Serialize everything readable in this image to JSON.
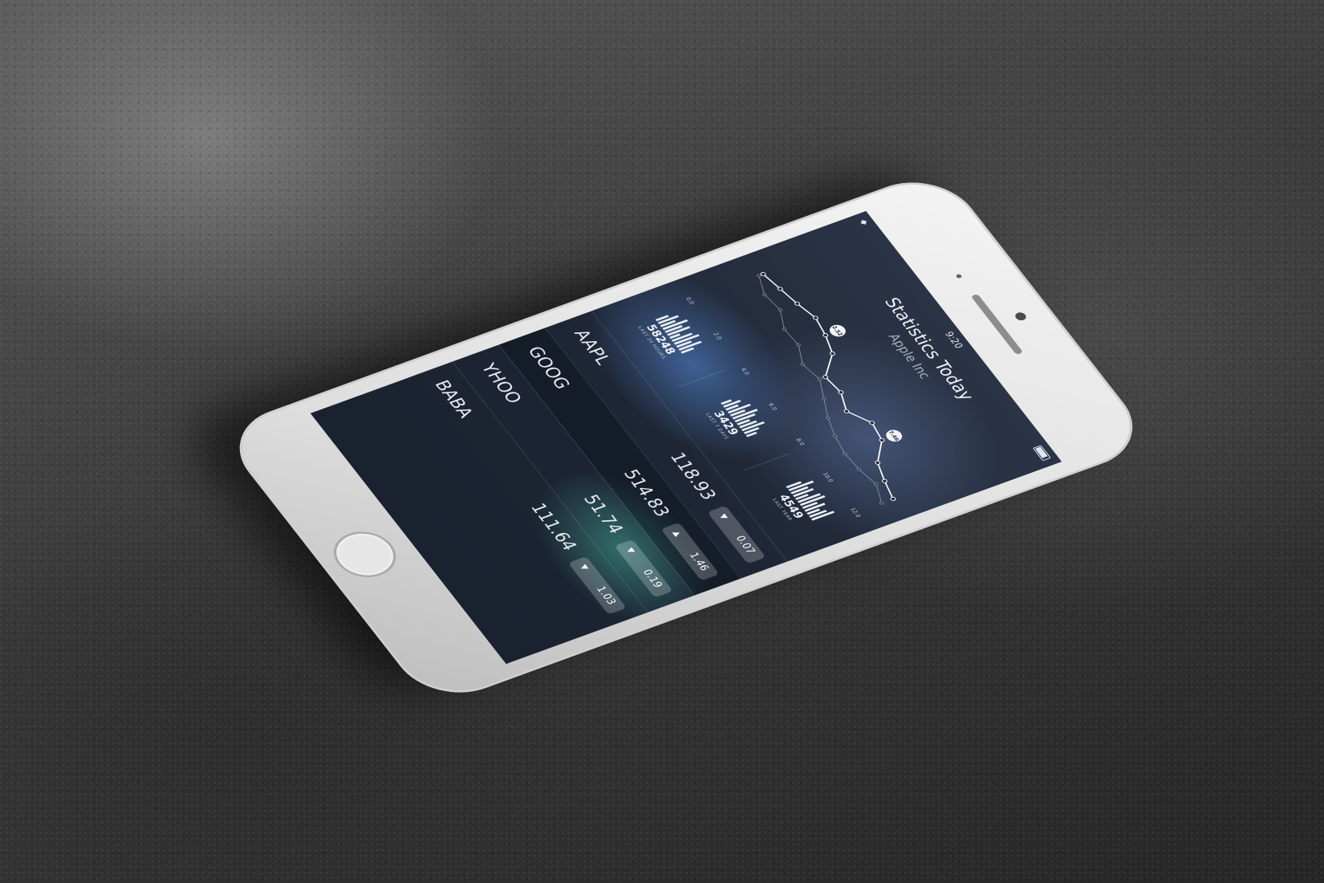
{
  "status_bar": {
    "time": "9:20",
    "wifi_icon": "wifi-icon",
    "battery_icon": "battery-icon"
  },
  "header": {
    "title": "Statistics Today",
    "subtitle": "Apple Inc"
  },
  "chart_data": {
    "type": "line",
    "x": [
      0,
      1,
      2,
      3,
      4,
      5,
      6,
      7,
      8,
      9,
      10,
      11,
      12,
      13
    ],
    "x_ticks": [
      "0.0",
      "2.0",
      "4.0",
      "6.0",
      "8.0",
      "10.0",
      "12.0"
    ],
    "series": [
      {
        "values": [
          4.2,
          4.5,
          4.8,
          5.2,
          5.0,
          4.6,
          3.2,
          3.4,
          2.9,
          3.8,
          3.6,
          2.4,
          2.0,
          1.7
        ]
      },
      {
        "values": [
          3.9,
          3.4,
          3.6,
          3.0,
          3.1,
          2.5,
          2.8,
          2.2,
          1.6,
          1.2,
          1.0,
          1.1,
          1.4,
          0.9
        ]
      }
    ],
    "annotations": [
      "2.52",
      "7.46"
    ],
    "ylim": [
      0,
      6
    ]
  },
  "stats": [
    {
      "value": "58248",
      "label": "LAST 24 HOURS",
      "bars": [
        0.5,
        0.8,
        0.6,
        1.0,
        0.7,
        0.9,
        0.4,
        0.8,
        1.0,
        0.6,
        0.9,
        0.5
      ]
    },
    {
      "value": "3429",
      "label": "LAST 7 DAYS",
      "bars": [
        0.4,
        0.7,
        0.5,
        0.9,
        0.6,
        1.0,
        0.8,
        0.5,
        0.7,
        0.9,
        0.6,
        0.4
      ]
    },
    {
      "value": "4549",
      "label": "LAST YEAR",
      "bars": [
        0.6,
        1.0,
        0.7,
        0.8,
        0.5,
        0.9,
        1.0,
        0.6,
        0.8,
        0.5,
        0.7,
        0.9
      ]
    }
  ],
  "stocks": [
    {
      "ticker": "AAPL",
      "price": "118.93",
      "change": "0.07",
      "direction": "down"
    },
    {
      "ticker": "GOOG",
      "price": "514.83",
      "change": "1.46",
      "direction": "up"
    },
    {
      "ticker": "YHOO",
      "price": "51.74",
      "change": "0.19",
      "direction": "down"
    },
    {
      "ticker": "BABA",
      "price": "111.64",
      "change": "1.03",
      "direction": "down"
    }
  ],
  "arrows": {
    "up": "▲",
    "down": "▼"
  }
}
